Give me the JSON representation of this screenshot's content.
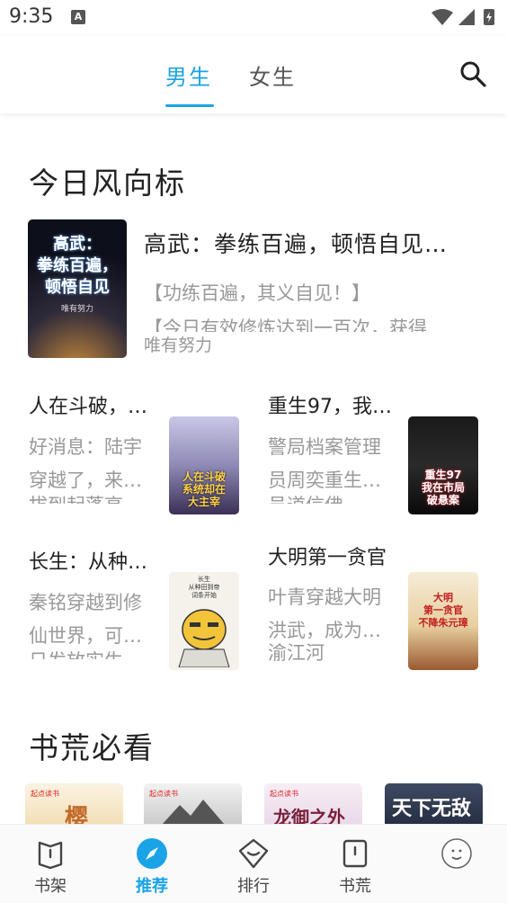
{
  "status": {
    "time": "9:35",
    "notif_letter": "A"
  },
  "header": {
    "tabs": [
      {
        "label": "男生",
        "active": true
      },
      {
        "label": "女生",
        "active": false
      }
    ]
  },
  "sections": {
    "wind": {
      "title": "今日风向标"
    },
    "must_read": {
      "title": "书荒必看"
    }
  },
  "featured": {
    "title": "高武：拳练百遍，顿悟自见…",
    "desc1": "【功练百遍，其义自见！】",
    "desc2": "【今日有效修炼达到一百次，获得",
    "author": "唯有努力",
    "cover_text": [
      "高武：",
      "拳练百遍，",
      "顿悟自见"
    ],
    "cover_author": "唯有努力"
  },
  "grid": [
    {
      "title": "人在斗破，…",
      "line1": "好消息：陆宇",
      "line2": "穿越了，来…",
      "clip": "拔到起蓬高",
      "cover_text": [
        "人在斗破",
        "系统却在",
        "大主宰"
      ]
    },
    {
      "title": "重生97，我…",
      "line1": "警局档案管理",
      "line2": "员周奕重生…",
      "clip": "员道信佛",
      "cover_text": [
        "重生97",
        "我在市局",
        "破悬案"
      ]
    },
    {
      "title": "长生：从种…",
      "line1": "秦铭穿越到修",
      "line2": "仙世界，可…",
      "clip": "日发放实生",
      "cover_text": [
        "长生",
        "从种田到帝",
        "词条开始"
      ]
    },
    {
      "title": "大明第一贪官",
      "line1": "叶青穿越大明",
      "line2": "洪武，成为…",
      "line3": "渝江河",
      "cover_text": [
        "大明",
        "第一贪官",
        "不降朱元璋"
      ]
    }
  ],
  "shelf_covers": [
    {
      "badge": "起点读书",
      "text": "樱"
    },
    {
      "badge": "起点读书",
      "text": ""
    },
    {
      "badge": "起点读书",
      "text": "龙御之外"
    },
    {
      "badge": "",
      "text": "天下无敌"
    }
  ],
  "bottom_nav": [
    {
      "label": "书架",
      "icon": "book-open-icon",
      "active": false
    },
    {
      "label": "推荐",
      "icon": "compass-icon",
      "active": true
    },
    {
      "label": "排行",
      "icon": "ranking-icon",
      "active": false
    },
    {
      "label": "书荒",
      "icon": "book-icon",
      "active": false
    },
    {
      "label": "",
      "icon": "avatar-icon",
      "active": false
    }
  ],
  "colors": {
    "accent": "#1aa3e6",
    "muted": "#999999"
  }
}
